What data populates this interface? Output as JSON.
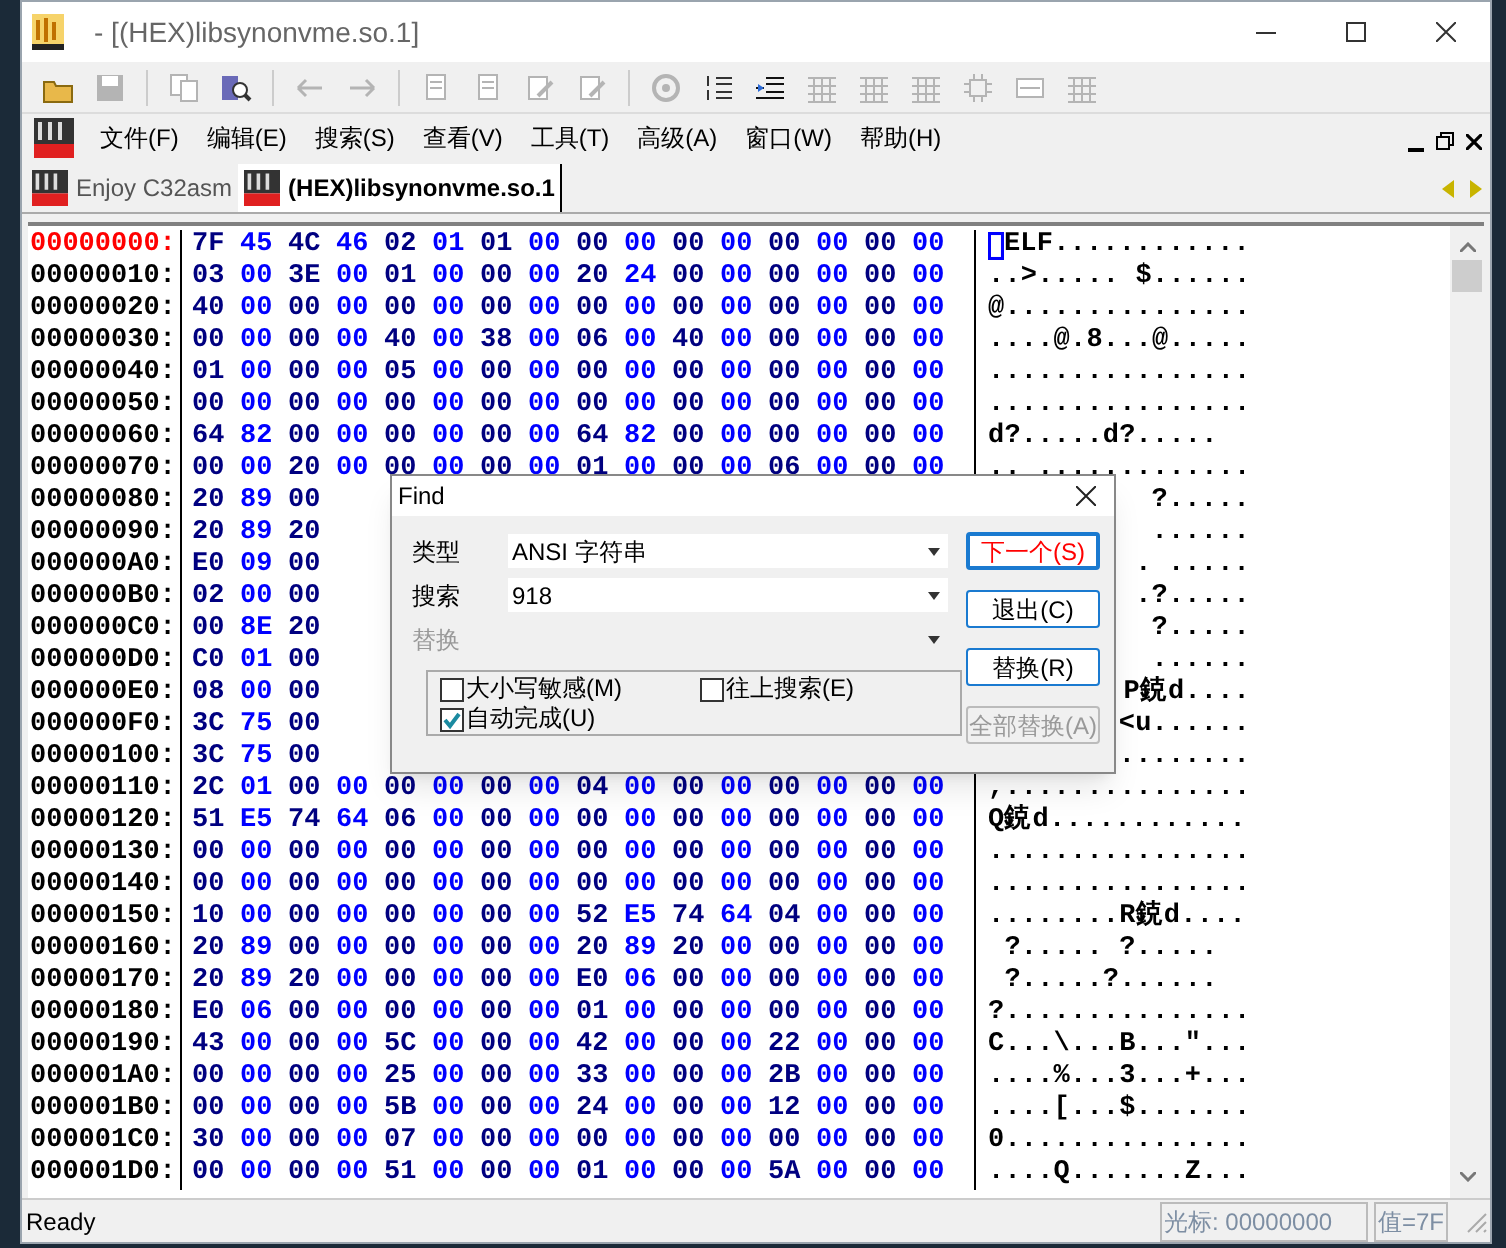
{
  "window": {
    "title": "- [(HEX)libsynonvme.so.1]"
  },
  "toolbar": [
    {
      "kind": "open",
      "disabled": false
    },
    {
      "kind": "save",
      "disabled": true
    },
    {
      "kind": "sep"
    },
    {
      "kind": "copy",
      "disabled": true
    },
    {
      "kind": "find",
      "disabled": false
    },
    {
      "kind": "sep"
    },
    {
      "kind": "back",
      "disabled": true
    },
    {
      "kind": "forward",
      "disabled": true
    },
    {
      "kind": "sep"
    },
    {
      "kind": "doc",
      "disabled": true
    },
    {
      "kind": "doc",
      "disabled": true
    },
    {
      "kind": "pencil",
      "disabled": true
    },
    {
      "kind": "pencil",
      "disabled": true
    },
    {
      "kind": "sep"
    },
    {
      "kind": "gear",
      "disabled": true
    },
    {
      "kind": "list",
      "disabled": false
    },
    {
      "kind": "indent",
      "disabled": false
    },
    {
      "kind": "grid",
      "disabled": true
    },
    {
      "kind": "grid",
      "disabled": true
    },
    {
      "kind": "grid",
      "disabled": true
    },
    {
      "kind": "chip",
      "disabled": true
    },
    {
      "kind": "panel",
      "disabled": true
    },
    {
      "kind": "grid",
      "disabled": true
    }
  ],
  "menu": [
    "文件(F)",
    "编辑(E)",
    "搜索(S)",
    "查看(V)",
    "工具(T)",
    "高级(A)",
    "窗口(W)",
    "帮助(H)"
  ],
  "tabs": [
    {
      "label": "Enjoy C32asm",
      "selected": false
    },
    {
      "label": "(HEX)libsynonvme.so.1",
      "selected": true
    }
  ],
  "hex_view": {
    "rows": [
      {
        "kind": "full",
        "address": "00000000:",
        "current": true,
        "bytes": [
          "7F",
          "45",
          "4C",
          "46",
          "02",
          "01",
          "01",
          "00",
          "00",
          "00",
          "00",
          "00",
          "00",
          "00",
          "00",
          "00"
        ],
        "ascii": "ELF............",
        "cursor": true
      },
      {
        "kind": "full",
        "address": "00000010:",
        "current": false,
        "bytes": [
          "03",
          "00",
          "3E",
          "00",
          "01",
          "00",
          "00",
          "00",
          "20",
          "24",
          "00",
          "00",
          "00",
          "00",
          "00",
          "00"
        ],
        "ascii": "..>..... $......",
        "cursor": false
      },
      {
        "kind": "full",
        "address": "00000020:",
        "current": false,
        "bytes": [
          "40",
          "00",
          "00",
          "00",
          "00",
          "00",
          "00",
          "00",
          "00",
          "00",
          "00",
          "00",
          "00",
          "00",
          "00",
          "00"
        ],
        "ascii": "@...............",
        "cursor": false
      },
      {
        "kind": "full",
        "address": "00000030:",
        "current": false,
        "bytes": [
          "00",
          "00",
          "00",
          "00",
          "40",
          "00",
          "38",
          "00",
          "06",
          "00",
          "40",
          "00",
          "00",
          "00",
          "00",
          "00"
        ],
        "ascii": "....@.8...@.....",
        "cursor": false
      },
      {
        "kind": "full",
        "address": "00000040:",
        "current": false,
        "bytes": [
          "01",
          "00",
          "00",
          "00",
          "05",
          "00",
          "00",
          "00",
          "00",
          "00",
          "00",
          "00",
          "00",
          "00",
          "00",
          "00"
        ],
        "ascii": "................",
        "cursor": false
      },
      {
        "kind": "full",
        "address": "00000050:",
        "current": false,
        "bytes": [
          "00",
          "00",
          "00",
          "00",
          "00",
          "00",
          "00",
          "00",
          "00",
          "00",
          "00",
          "00",
          "00",
          "00",
          "00",
          "00"
        ],
        "ascii": "................",
        "cursor": false
      },
      {
        "kind": "full",
        "address": "00000060:",
        "current": false,
        "bytes": [
          "64",
          "82",
          "00",
          "00",
          "00",
          "00",
          "00",
          "00",
          "64",
          "82",
          "00",
          "00",
          "00",
          "00",
          "00",
          "00"
        ],
        "ascii": "d?.....d?.....",
        "cursor": false
      },
      {
        "kind": "full",
        "address": "00000070:",
        "current": false,
        "bytes": [
          "00",
          "00",
          "20",
          "00",
          "00",
          "00",
          "00",
          "00",
          "01",
          "00",
          "00",
          "00",
          "06",
          "00",
          "00",
          "00"
        ],
        "ascii": ".. .............",
        "cursor": false
      },
      {
        "kind": "partial",
        "address": "00000080:",
        "current": false,
        "bytes": [
          "20",
          "89",
          "00"
        ],
        "ascii": "?.....",
        "cursor": false
      },
      {
        "kind": "partial",
        "address": "00000090:",
        "current": false,
        "bytes": [
          "20",
          "89",
          "20"
        ],
        "ascii": "......",
        "cursor": false
      },
      {
        "kind": "partial",
        "address": "000000A0:",
        "current": false,
        "bytes": [
          "E0",
          "09",
          "00"
        ],
        "ascii": ". .....",
        "cursor": false
      },
      {
        "kind": "partial",
        "address": "000000B0:",
        "current": false,
        "bytes": [
          "02",
          "00",
          "00"
        ],
        "ascii": ".?.....",
        "cursor": false
      },
      {
        "kind": "partial",
        "address": "000000C0:",
        "current": false,
        "bytes": [
          "00",
          "8E",
          "20"
        ],
        "ascii": "?.....",
        "cursor": false
      },
      {
        "kind": "partial",
        "address": "000000D0:",
        "current": false,
        "bytes": [
          "C0",
          "01",
          "00"
        ],
        "ascii": "......",
        "cursor": false
      },
      {
        "kind": "partial",
        "address": "000000E0:",
        "current": false,
        "bytes": [
          "08",
          "00",
          "00"
        ],
        "ascii": "P鋴d....",
        "cursor": false
      },
      {
        "kind": "partial",
        "address": "000000F0:",
        "current": false,
        "bytes": [
          "3C",
          "75",
          "00"
        ],
        "ascii": "<u......",
        "cursor": false
      },
      {
        "kind": "partial",
        "address": "00000100:",
        "current": false,
        "bytes": [
          "3C",
          "75",
          "00"
        ],
        "ascii": "........",
        "cursor": false
      },
      {
        "kind": "full",
        "address": "00000110:",
        "current": false,
        "bytes": [
          "2C",
          "01",
          "00",
          "00",
          "00",
          "00",
          "00",
          "00",
          "04",
          "00",
          "00",
          "00",
          "00",
          "00",
          "00",
          "00"
        ],
        "ascii": ",...............",
        "cursor": false
      },
      {
        "kind": "full",
        "address": "00000120:",
        "current": false,
        "bytes": [
          "51",
          "E5",
          "74",
          "64",
          "06",
          "00",
          "00",
          "00",
          "00",
          "00",
          "00",
          "00",
          "00",
          "00",
          "00",
          "00"
        ],
        "ascii": "Q鋴d............",
        "cursor": false
      },
      {
        "kind": "full",
        "address": "00000130:",
        "current": false,
        "bytes": [
          "00",
          "00",
          "00",
          "00",
          "00",
          "00",
          "00",
          "00",
          "00",
          "00",
          "00",
          "00",
          "00",
          "00",
          "00",
          "00"
        ],
        "ascii": "................",
        "cursor": false
      },
      {
        "kind": "full",
        "address": "00000140:",
        "current": false,
        "bytes": [
          "00",
          "00",
          "00",
          "00",
          "00",
          "00",
          "00",
          "00",
          "00",
          "00",
          "00",
          "00",
          "00",
          "00",
          "00",
          "00"
        ],
        "ascii": "................",
        "cursor": false
      },
      {
        "kind": "full",
        "address": "00000150:",
        "current": false,
        "bytes": [
          "10",
          "00",
          "00",
          "00",
          "00",
          "00",
          "00",
          "00",
          "52",
          "E5",
          "74",
          "64",
          "04",
          "00",
          "00",
          "00"
        ],
        "ascii": "........R鋴d....",
        "cursor": false
      },
      {
        "kind": "full",
        "address": "00000160:",
        "current": false,
        "bytes": [
          "20",
          "89",
          "00",
          "00",
          "00",
          "00",
          "00",
          "00",
          "20",
          "89",
          "20",
          "00",
          "00",
          "00",
          "00",
          "00"
        ],
        "ascii": " ?..... ?.....",
        "cursor": false
      },
      {
        "kind": "full",
        "address": "00000170:",
        "current": false,
        "bytes": [
          "20",
          "89",
          "20",
          "00",
          "00",
          "00",
          "00",
          "00",
          "E0",
          "06",
          "00",
          "00",
          "00",
          "00",
          "00",
          "00"
        ],
        "ascii": " ?.....?......",
        "cursor": false
      },
      {
        "kind": "full",
        "address": "00000180:",
        "current": false,
        "bytes": [
          "E0",
          "06",
          "00",
          "00",
          "00",
          "00",
          "00",
          "00",
          "01",
          "00",
          "00",
          "00",
          "00",
          "00",
          "00",
          "00"
        ],
        "ascii": "?...............",
        "cursor": false
      },
      {
        "kind": "full",
        "address": "00000190:",
        "current": false,
        "bytes": [
          "43",
          "00",
          "00",
          "00",
          "5C",
          "00",
          "00",
          "00",
          "42",
          "00",
          "00",
          "00",
          "22",
          "00",
          "00",
          "00"
        ],
        "ascii": "C...\\...B...\"...",
        "cursor": false
      },
      {
        "kind": "full",
        "address": "000001A0:",
        "current": false,
        "bytes": [
          "00",
          "00",
          "00",
          "00",
          "25",
          "00",
          "00",
          "00",
          "33",
          "00",
          "00",
          "00",
          "2B",
          "00",
          "00",
          "00"
        ],
        "ascii": "....%...3...+...",
        "cursor": false
      },
      {
        "kind": "full",
        "address": "000001B0:",
        "current": false,
        "bytes": [
          "00",
          "00",
          "00",
          "00",
          "5B",
          "00",
          "00",
          "00",
          "24",
          "00",
          "00",
          "00",
          "12",
          "00",
          "00",
          "00"
        ],
        "ascii": "....[...$.......",
        "cursor": false
      },
      {
        "kind": "full",
        "address": "000001C0:",
        "current": false,
        "bytes": [
          "30",
          "00",
          "00",
          "00",
          "07",
          "00",
          "00",
          "00",
          "00",
          "00",
          "00",
          "00",
          "00",
          "00",
          "00",
          "00"
        ],
        "ascii": "0...............",
        "cursor": false
      },
      {
        "kind": "full",
        "address": "000001D0:",
        "current": false,
        "bytes": [
          "00",
          "00",
          "00",
          "00",
          "51",
          "00",
          "00",
          "00",
          "01",
          "00",
          "00",
          "00",
          "5A",
          "00",
          "00",
          "00"
        ],
        "ascii": "....Q.......Z...",
        "cursor": false
      }
    ]
  },
  "find_dialog": {
    "title": "Find",
    "fields": [
      {
        "label": "类型",
        "value": "ANSI 字符串",
        "disabled": false
      },
      {
        "label": "搜索",
        "value": "918",
        "disabled": false
      },
      {
        "label": "替换",
        "disabled": true
      }
    ],
    "options": [
      {
        "label": "大小写敏感(M)",
        "checked": false
      },
      {
        "label": "往上搜索(E)",
        "checked": false
      },
      {
        "label": "自动完成(U)",
        "checked": true
      }
    ],
    "buttons": [
      {
        "label": "下一个(S)",
        "default": true,
        "disabled": false
      },
      {
        "label": "退出(C)",
        "default": false,
        "disabled": false
      },
      {
        "label": "替换(R)",
        "default": false,
        "disabled": false
      },
      {
        "label": "全部替换(A)",
        "default": false,
        "disabled": true
      }
    ]
  },
  "status_bar": {
    "message": "Ready",
    "cursor": "光标: 00000000",
    "value": "值=7F"
  }
}
